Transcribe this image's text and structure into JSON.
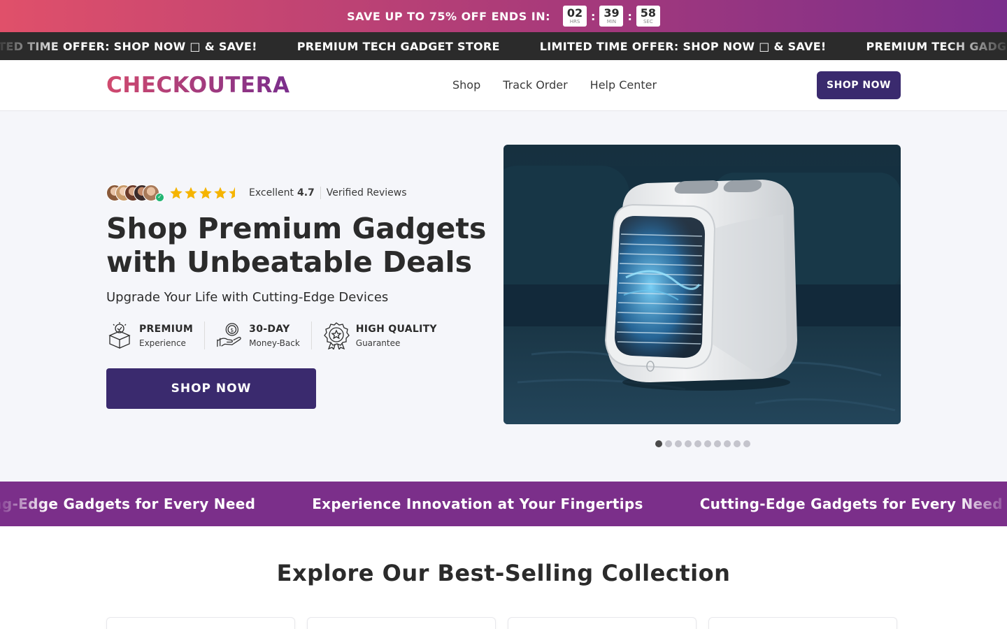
{
  "countdown": {
    "text": "SAVE UP TO 75% OFF ENDS IN:",
    "hours": "02",
    "hours_label": "HRS",
    "minutes": "39",
    "minutes_label": "MIN",
    "seconds": "58",
    "seconds_label": "SEC",
    "separator": ":"
  },
  "ticker": {
    "items": [
      "LIMITED TIME OFFER: SHOP NOW □ & SAVE!",
      "PREMIUM TECH GADGET STORE",
      "LIMITED TIME OFFER: SHOP NOW □ & SAVE!",
      "PREMIUM TECH GADGET STORE"
    ]
  },
  "header": {
    "logo": "CHECKOUTERA",
    "nav": [
      "Shop",
      "Track Order",
      "Help Center"
    ],
    "cta": "SHOP NOW"
  },
  "hero": {
    "rating_label": "Excellent",
    "rating_score": "4.7",
    "rating_verified": "Verified Reviews",
    "title": "Shop Premium Gadgets with Unbeatable Deals",
    "subtitle": "Upgrade Your Life with Cutting-Edge Devices",
    "features": [
      {
        "title": "PREMIUM",
        "desc": "Experience",
        "icon": "gift-box-icon"
      },
      {
        "title": "30-DAY",
        "desc": "Money-Back",
        "icon": "money-hand-icon"
      },
      {
        "title": "HIGH QUALITY",
        "desc": "Guarantee",
        "icon": "award-badge-icon"
      }
    ],
    "cta": "SHOP NOW",
    "carousel_active_slide": 1,
    "carousel_slide_count": 10
  },
  "marquee": {
    "items": [
      "Cutting-Edge Gadgets for Every Need",
      "Experience Innovation at Your Fingertips",
      "Cutting-Edge Gadgets for Every Need"
    ]
  },
  "collection": {
    "title": "Explore Our Best-Selling Collection"
  },
  "colors": {
    "primary": "#3a2a6e",
    "accent_purple": "#7b2f8a",
    "accent_pink": "#e0506a",
    "star": "#f5b400",
    "ticker_bg": "#2b2b2b"
  }
}
